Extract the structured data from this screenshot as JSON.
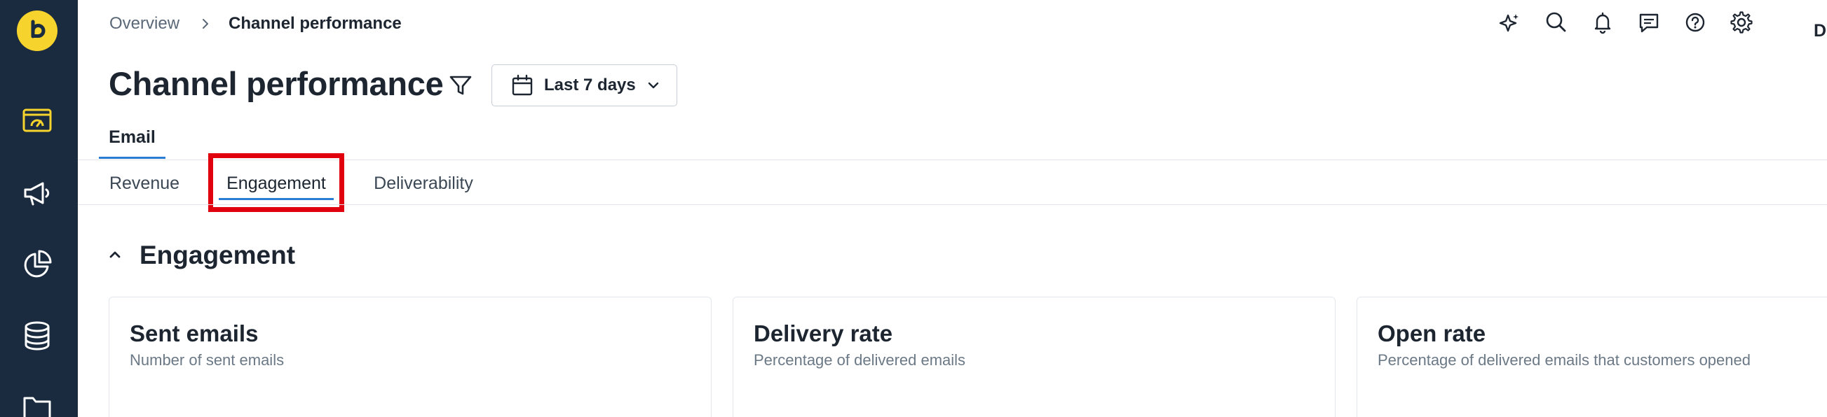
{
  "sidebar": {
    "logo_icon": "brand-logo-icon",
    "items": [
      {
        "icon": "dashboard-icon",
        "active": true
      },
      {
        "icon": "megaphone-icon",
        "active": false
      },
      {
        "icon": "pie-chart-icon",
        "active": false
      },
      {
        "icon": "database-icon",
        "active": false
      },
      {
        "icon": "folder-icon",
        "active": false
      }
    ]
  },
  "breadcrumb": {
    "parent": "Overview",
    "current": "Channel performance"
  },
  "topbar": {
    "icons": [
      "sparkle-icon",
      "search-icon",
      "bell-icon",
      "chat-icon",
      "help-icon",
      "gear-icon"
    ],
    "avatar_initial": "D"
  },
  "header": {
    "title": "Channel performance",
    "date_range": "Last 7 days"
  },
  "channel_tabs": [
    {
      "label": "Email",
      "active": true
    }
  ],
  "sub_tabs": [
    {
      "label": "Revenue",
      "active": false
    },
    {
      "label": "Engagement",
      "active": true
    },
    {
      "label": "Deliverability",
      "active": false
    }
  ],
  "section": {
    "title": "Engagement"
  },
  "cards": [
    {
      "title": "Sent emails",
      "subtitle": "Number of sent emails"
    },
    {
      "title": "Delivery rate",
      "subtitle": "Percentage of delivered emails"
    },
    {
      "title": "Open rate",
      "subtitle": "Percentage of delivered emails that customers opened"
    }
  ],
  "colors": {
    "sidebar_bg": "#1b2b3f",
    "brand_yellow": "#f6d32d",
    "accent_blue": "#2b7cd3",
    "highlight_red": "#e0000e"
  }
}
